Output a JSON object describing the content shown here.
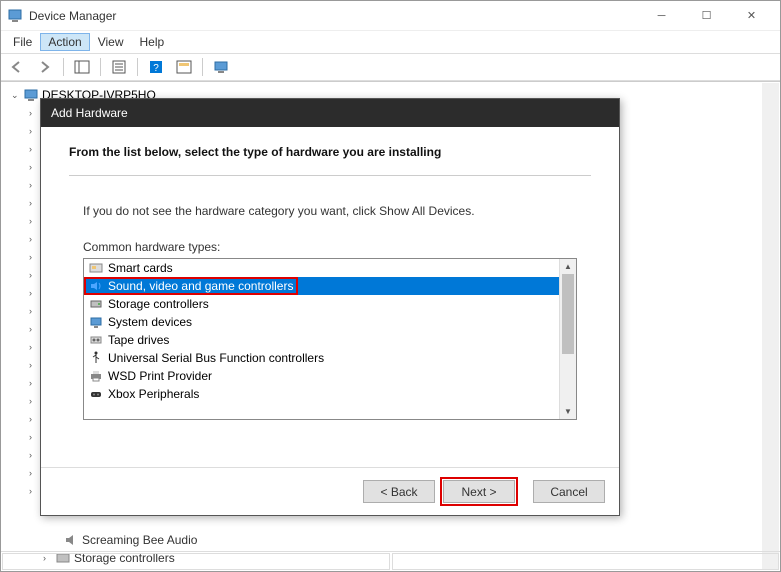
{
  "window": {
    "title": "Device Manager"
  },
  "menu": {
    "file": "File",
    "action": "Action",
    "view": "View",
    "help": "Help"
  },
  "tree": {
    "root": "DESKTOP-IVRP5HO",
    "bottom_visible": [
      "Screaming Bee Audio",
      "Storage controllers"
    ]
  },
  "dialog": {
    "title": "Add Hardware",
    "heading": "From the list below, select the type of hardware you are installing",
    "info": "If you do not see the hardware category you want, click Show All Devices.",
    "list_label": "Common hardware types:",
    "items": [
      {
        "label": "Smart cards",
        "icon": "smartcard-icon"
      },
      {
        "label": "Sound, video and game controllers",
        "icon": "sound-icon",
        "selected": true
      },
      {
        "label": "Storage controllers",
        "icon": "storage-icon"
      },
      {
        "label": "System devices",
        "icon": "system-icon"
      },
      {
        "label": "Tape drives",
        "icon": "tape-icon"
      },
      {
        "label": "Universal Serial Bus Function controllers",
        "icon": "usb-icon"
      },
      {
        "label": "WSD Print Provider",
        "icon": "printer-icon"
      },
      {
        "label": "Xbox Peripherals",
        "icon": "xbox-icon"
      }
    ],
    "buttons": {
      "back": "< Back",
      "next": "Next >",
      "cancel": "Cancel"
    }
  }
}
